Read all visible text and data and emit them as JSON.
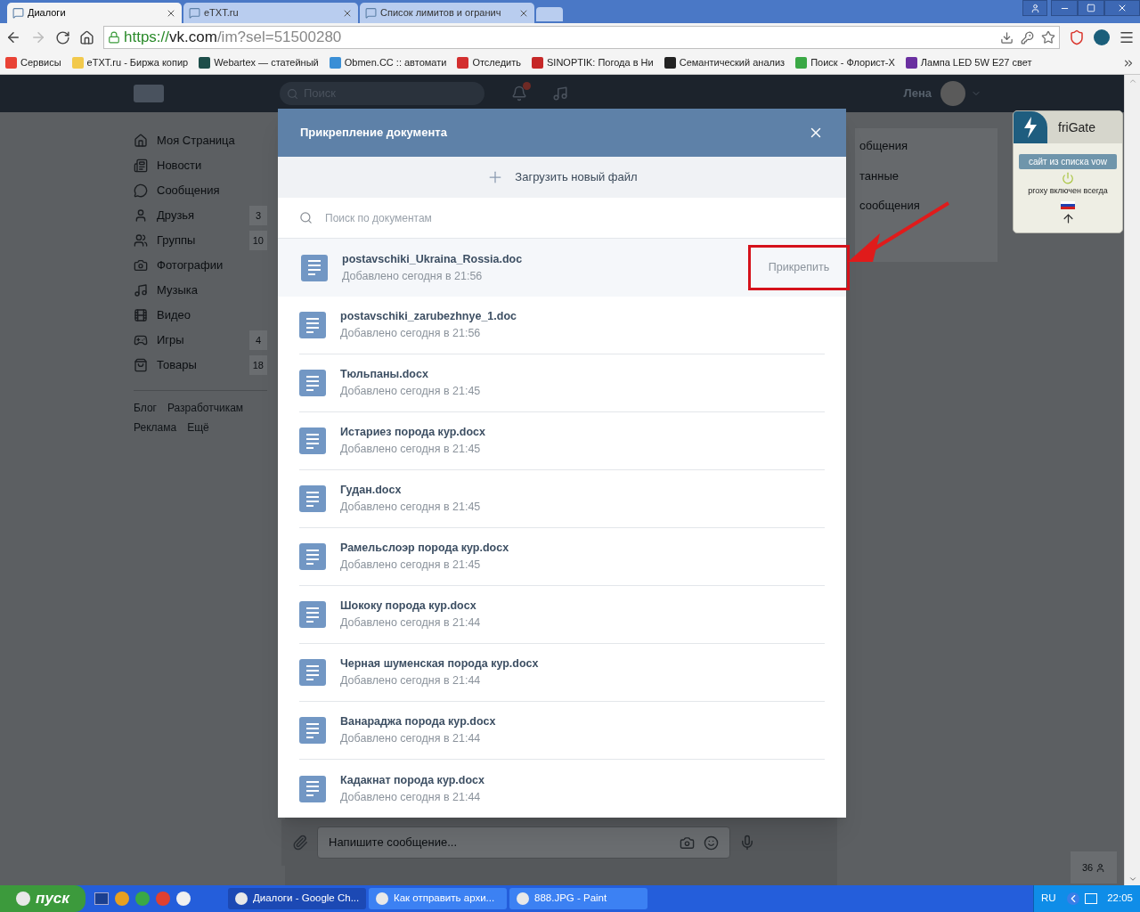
{
  "browser": {
    "tabs": [
      {
        "label": "Диалоги",
        "selected": true
      },
      {
        "label": "eTXT.ru",
        "selected": false
      },
      {
        "label": "Список лимитов и огранич",
        "selected": false
      }
    ],
    "address": {
      "scheme": "https://",
      "host": "vk.com",
      "path": "/im?sel=51500280"
    },
    "bookmarks": [
      "Сервисы",
      "eTXT.ru - Биржа копир",
      "Webartex — статейный",
      "Obmen.CC :: автомати",
      "Отследить",
      "SINOPTIK: Погода в Ни",
      "Семантический анализ",
      "Поиск - Флорист-Х",
      "Лампа LED 5W E27 свет"
    ]
  },
  "vk": {
    "header": {
      "search_placeholder": "Поиск",
      "user_name": "Лена"
    },
    "sidebar": {
      "items": [
        {
          "label": "Моя Страница"
        },
        {
          "label": "Новости"
        },
        {
          "label": "Сообщения"
        },
        {
          "label": "Друзья",
          "count": "3"
        },
        {
          "label": "Группы",
          "count": "10"
        },
        {
          "label": "Фотографии"
        },
        {
          "label": "Музыка"
        },
        {
          "label": "Видео"
        },
        {
          "label": "Игры",
          "count": "4"
        },
        {
          "label": "Товары",
          "count": "18"
        }
      ],
      "footer_links": [
        "Блог",
        "Разработчикам",
        "Реклама",
        "Ещё"
      ]
    },
    "right_menu": [
      "общения",
      "танные",
      "сообщения"
    ],
    "composer": {
      "placeholder": "Напишите сообщение..."
    },
    "online_count": "36"
  },
  "modal": {
    "title": "Прикрепление документа",
    "upload_label": "Загрузить новый файл",
    "search_placeholder": "Поиск по документам",
    "attach_label": "Прикрепить",
    "documents": [
      {
        "name": "postavschiki_Ukraina_Rossia.doc",
        "added": "Добавлено сегодня в 21:56",
        "selected": true
      },
      {
        "name": "postavschiki_zarubezhnye_1.doc",
        "added": "Добавлено сегодня в 21:56",
        "selected": false
      },
      {
        "name": "Тюльпаны.docx",
        "added": "Добавлено сегодня в 21:45",
        "selected": false
      },
      {
        "name": "Истариез порода кур.docx",
        "added": "Добавлено сегодня в 21:45",
        "selected": false
      },
      {
        "name": "Гудан.docx",
        "added": "Добавлено сегодня в 21:45",
        "selected": false
      },
      {
        "name": "Рамельслоэр порода кур.docx",
        "added": "Добавлено сегодня в 21:45",
        "selected": false
      },
      {
        "name": "Шококу порода кур.docx",
        "added": "Добавлено сегодня в 21:44",
        "selected": false
      },
      {
        "name": "Черная шуменская порода кур.docx",
        "added": "Добавлено сегодня в 21:44",
        "selected": false
      },
      {
        "name": "Ванараджа порода кур.docx",
        "added": "Добавлено сегодня в 21:44",
        "selected": false
      },
      {
        "name": "Кадакнат порода кур.docx",
        "added": "Добавлено сегодня в 21:44",
        "selected": false
      }
    ]
  },
  "frigate": {
    "title": "friGate",
    "site_status": "сайт из списка vow",
    "proxy_status": "proxy включен всегда"
  },
  "taskbar": {
    "start": "пуск",
    "tasks": [
      {
        "label": "Диалоги - Google Ch...",
        "selected": true
      },
      {
        "label": "Как отправить архи...",
        "selected": false
      },
      {
        "label": "888.JPG - Paint",
        "selected": false
      }
    ],
    "language": "RU",
    "time": "22:05"
  }
}
